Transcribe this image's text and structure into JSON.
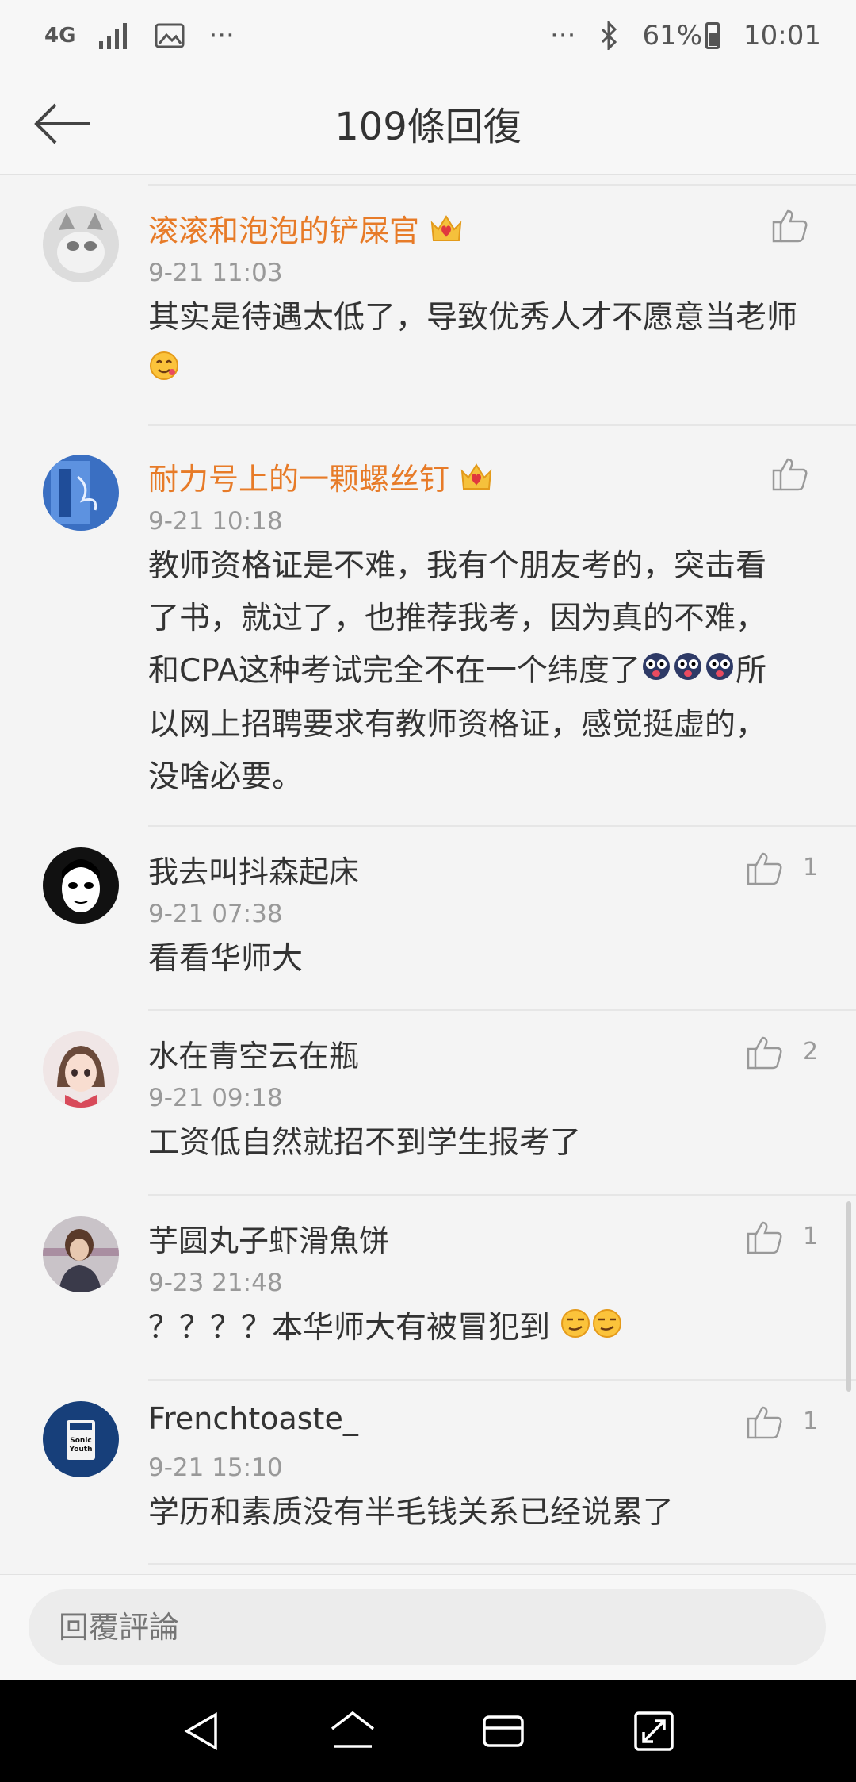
{
  "status_bar": {
    "network": "4G",
    "more_left": "···",
    "more_right": "···",
    "battery": "61%",
    "time": "10:01"
  },
  "header": {
    "title": "109條回復"
  },
  "comments": [
    {
      "username": "滚滚和泡泡的铲屎官",
      "vip": true,
      "time": "9-21 11:03",
      "content": "其实是待遇太低了，导致优秀人才不愿意当老师",
      "likes": ""
    },
    {
      "username": "耐力号上的一颗螺丝钉",
      "vip": true,
      "time": "9-21 10:18",
      "content_lines": [
        "教师资格证是不难，我有个朋友考的，突击看",
        "了书，就过了，也推荐我考，因为真的不难，",
        "和CPA这种考试完全不在一个纬度了",
        "所",
        "以网上招聘要求有教师资格证，感觉挺虚的，",
        "没啥必要。"
      ],
      "likes": ""
    },
    {
      "username": "我去叫抖森起床",
      "vip": false,
      "time": "9-21 07:38",
      "content": "看看华师大",
      "likes": "1"
    },
    {
      "username": "水在青空云在瓶",
      "vip": false,
      "time": "9-21 09:18",
      "content": "工资低自然就招不到学生报考了",
      "likes": "2"
    },
    {
      "username": "芋圆丸子虾滑魚饼",
      "vip": false,
      "time": "9-23 21:48",
      "content": "？？？？本华师大有被冒犯到",
      "likes": "1"
    },
    {
      "username": "Frenchtoaste_",
      "vip": false,
      "time": "9-21 15:10",
      "content": "学历和素质没有半毛钱关系已经说累了",
      "likes": "1"
    }
  ],
  "reply": {
    "placeholder": "回覆評論"
  },
  "colors": {
    "vip_name": "#e77b28",
    "text": "#333333",
    "meta": "#999999",
    "background": "#f4f4f4"
  }
}
